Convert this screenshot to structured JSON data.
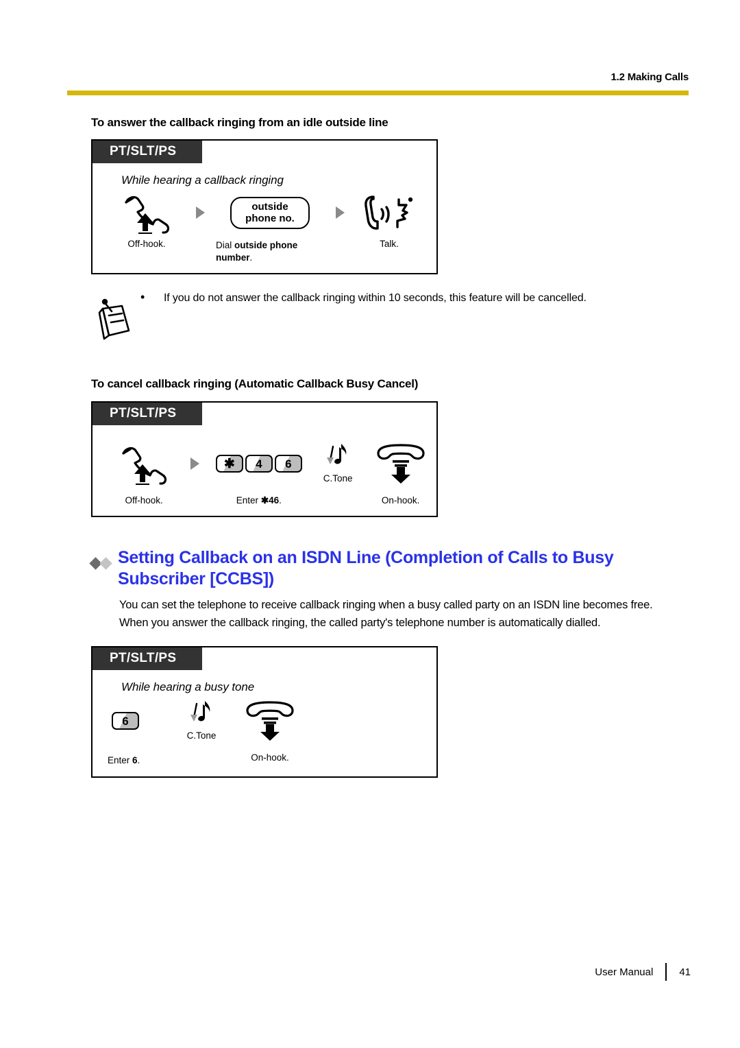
{
  "header": {
    "section_label": "1.2 Making Calls",
    "rule_color": "#d4b80c"
  },
  "section_one": {
    "heading": "To answer the callback ringing from an idle outside line",
    "procedure": {
      "tab_label": "PT/SLT/PS",
      "condition": "While hearing a callback ringing",
      "steps": [
        {
          "icon": "offhook-handset-icon",
          "caption": "Off-hook."
        },
        {
          "icon": "pill-button",
          "key_line_1": "outside",
          "key_line_2": "phone no.",
          "caption_prefix": "Dial ",
          "caption_bold": "outside phone number",
          "caption_suffix": "."
        },
        {
          "icon": "talk-handset-icon",
          "caption": "Talk."
        }
      ]
    },
    "note": {
      "icon": "note-paper-icon",
      "bullet": "•",
      "text": "If you do not answer the callback ringing within 10 seconds, this feature will be cancelled."
    }
  },
  "section_two": {
    "heading": "To cancel callback ringing (Automatic Callback Busy Cancel)",
    "procedure": {
      "tab_label": "PT/SLT/PS",
      "steps": [
        {
          "icon": "offhook-handset-icon",
          "caption": "Off-hook."
        },
        {
          "icon": "keypad-keys",
          "keys": [
            "✱",
            "4",
            "6"
          ],
          "caption_prefix": "Enter ",
          "caption_bold": "✱46",
          "caption_suffix": "."
        },
        {
          "icon": "music-note-icon",
          "tone_label": "C.Tone"
        },
        {
          "icon": "onhook-handset-icon",
          "caption": "On-hook."
        }
      ]
    }
  },
  "feature": {
    "diamond_colors": [
      "#6b6b6b",
      "#c4c4c4"
    ],
    "heading_color": "#2b32e8",
    "heading": "Setting Callback on an ISDN Line (Completion of Calls to Busy Subscriber [CCBS])",
    "paragraphs": [
      "You can set the telephone to receive callback ringing when a busy called party on an ISDN line becomes free.",
      "When you answer the callback ringing, the called party's telephone number is automatically dialled."
    ],
    "procedure": {
      "tab_label": "PT/SLT/PS",
      "condition": "While hearing a busy tone",
      "steps": [
        {
          "icon": "keypad-keys",
          "keys": [
            "6"
          ],
          "caption_prefix": "Enter ",
          "caption_bold": "6",
          "caption_suffix": "."
        },
        {
          "icon": "music-note-icon",
          "tone_label": "C.Tone"
        },
        {
          "icon": "onhook-handset-icon",
          "caption": "On-hook."
        }
      ]
    }
  },
  "footer": {
    "manual_label": "User Manual",
    "page_number": "41"
  }
}
